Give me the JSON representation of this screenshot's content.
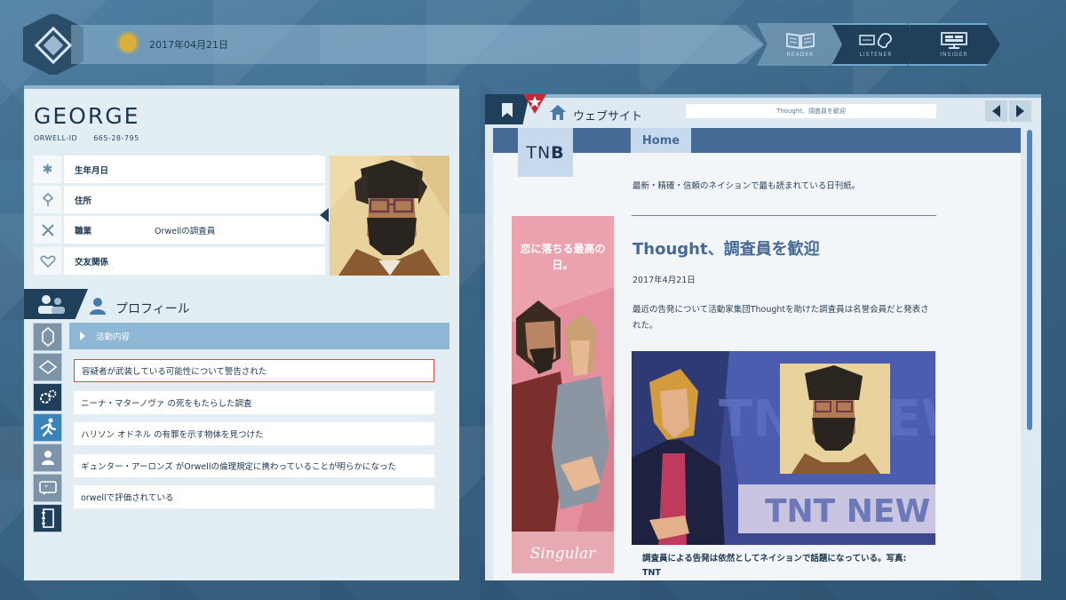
{
  "header": {
    "date": "2017年04月21日",
    "modes": [
      {
        "label": "READER"
      },
      {
        "label": "LISTENER"
      },
      {
        "label": "INSIDER"
      }
    ]
  },
  "profile": {
    "name": "GEORGE",
    "orwell_id_label": "ORWELL-ID",
    "orwell_id": "665-28-795",
    "fields": [
      {
        "label": "生年月日",
        "value": "",
        "icon": "asterisk-icon"
      },
      {
        "label": "住所",
        "value": "",
        "icon": "location-icon"
      },
      {
        "label": "職業",
        "value": "Orwellの調査員",
        "icon": "tools-icon"
      },
      {
        "label": "交友関係",
        "value": "",
        "icon": "heart-icon"
      }
    ],
    "section_title": "プロフィール",
    "activity_header": "活動内容",
    "activities": [
      "容疑者が武装している可能性について警告された",
      "ニーナ・マターノヴァ の死をもたらした調査",
      "ハリソン オドネル の有罪を示す物体を見つけた",
      "ギュンター・アーロンズ がOrwellの倫理規定に携わっていることが明らかになった",
      "orwellで評価されている"
    ]
  },
  "browser": {
    "section_title": "ウェブサイト",
    "url": "Thought、調査員を歓迎",
    "site": {
      "logo": "TN",
      "logo_bold": "B",
      "nav_home": "Home",
      "tagline": "最新・精確・信頼のネイションで最も読まれている日刊紙。",
      "ad_text": "恋に落ちる最高の日。",
      "ad_brand": "Singular",
      "article_title": "Thought、調査員を歓迎",
      "article_date": "2017年4月21日",
      "article_body": "最近の告発について活動家集団Thoughtを助けた調査員は名誉会員だと発表された。",
      "photo_banner": "TNT NEW",
      "photo_bg_text": "TNT NEW",
      "caption": "調査員による告発は依然としてネイションで話題になっている。写真: TNT"
    }
  },
  "colors": {
    "dark_navy": "#1f3f5a",
    "accent_blue": "#466a96",
    "selection_red": "#d94848",
    "ad_pink": "#e58f9e"
  }
}
